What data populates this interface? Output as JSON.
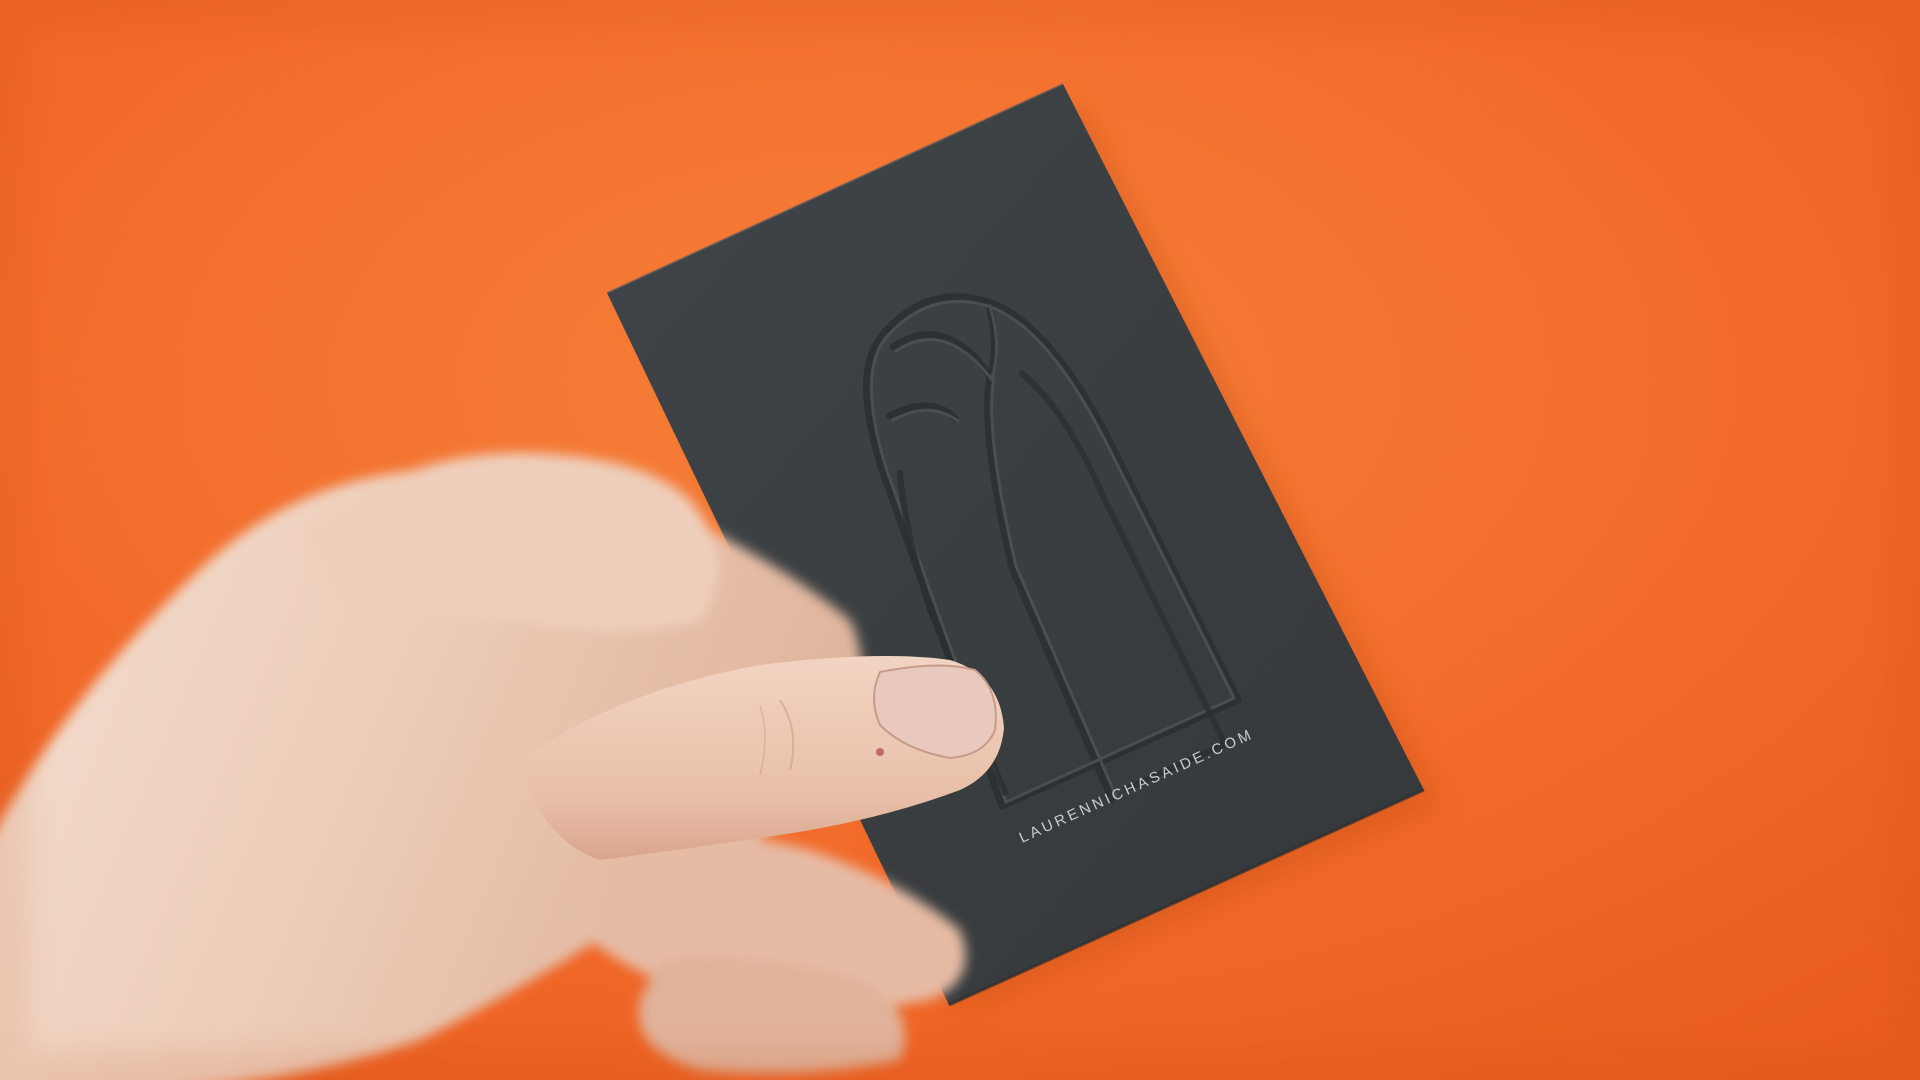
{
  "scene": {
    "description_free": true,
    "card": {
      "website_text": "LAURENNICHASAIDE.COM",
      "logo": "embossed-arched-window-logo"
    },
    "colors": {
      "background_orange": "#F26A2A",
      "background_orange_light": "#F7813A",
      "background_orange_dark": "#E85A1C",
      "card_dark_gray": "#3A3E40",
      "card_emboss_shadow": "#2E3133",
      "card_emboss_highlight": "#474B4D",
      "card_text": "#C9CCCD",
      "skin_light": "#F1D6C4",
      "skin_mid": "#E3B9A3",
      "skin_shadow": "#C9927A",
      "thumbnail": "#E9C9BE"
    }
  }
}
